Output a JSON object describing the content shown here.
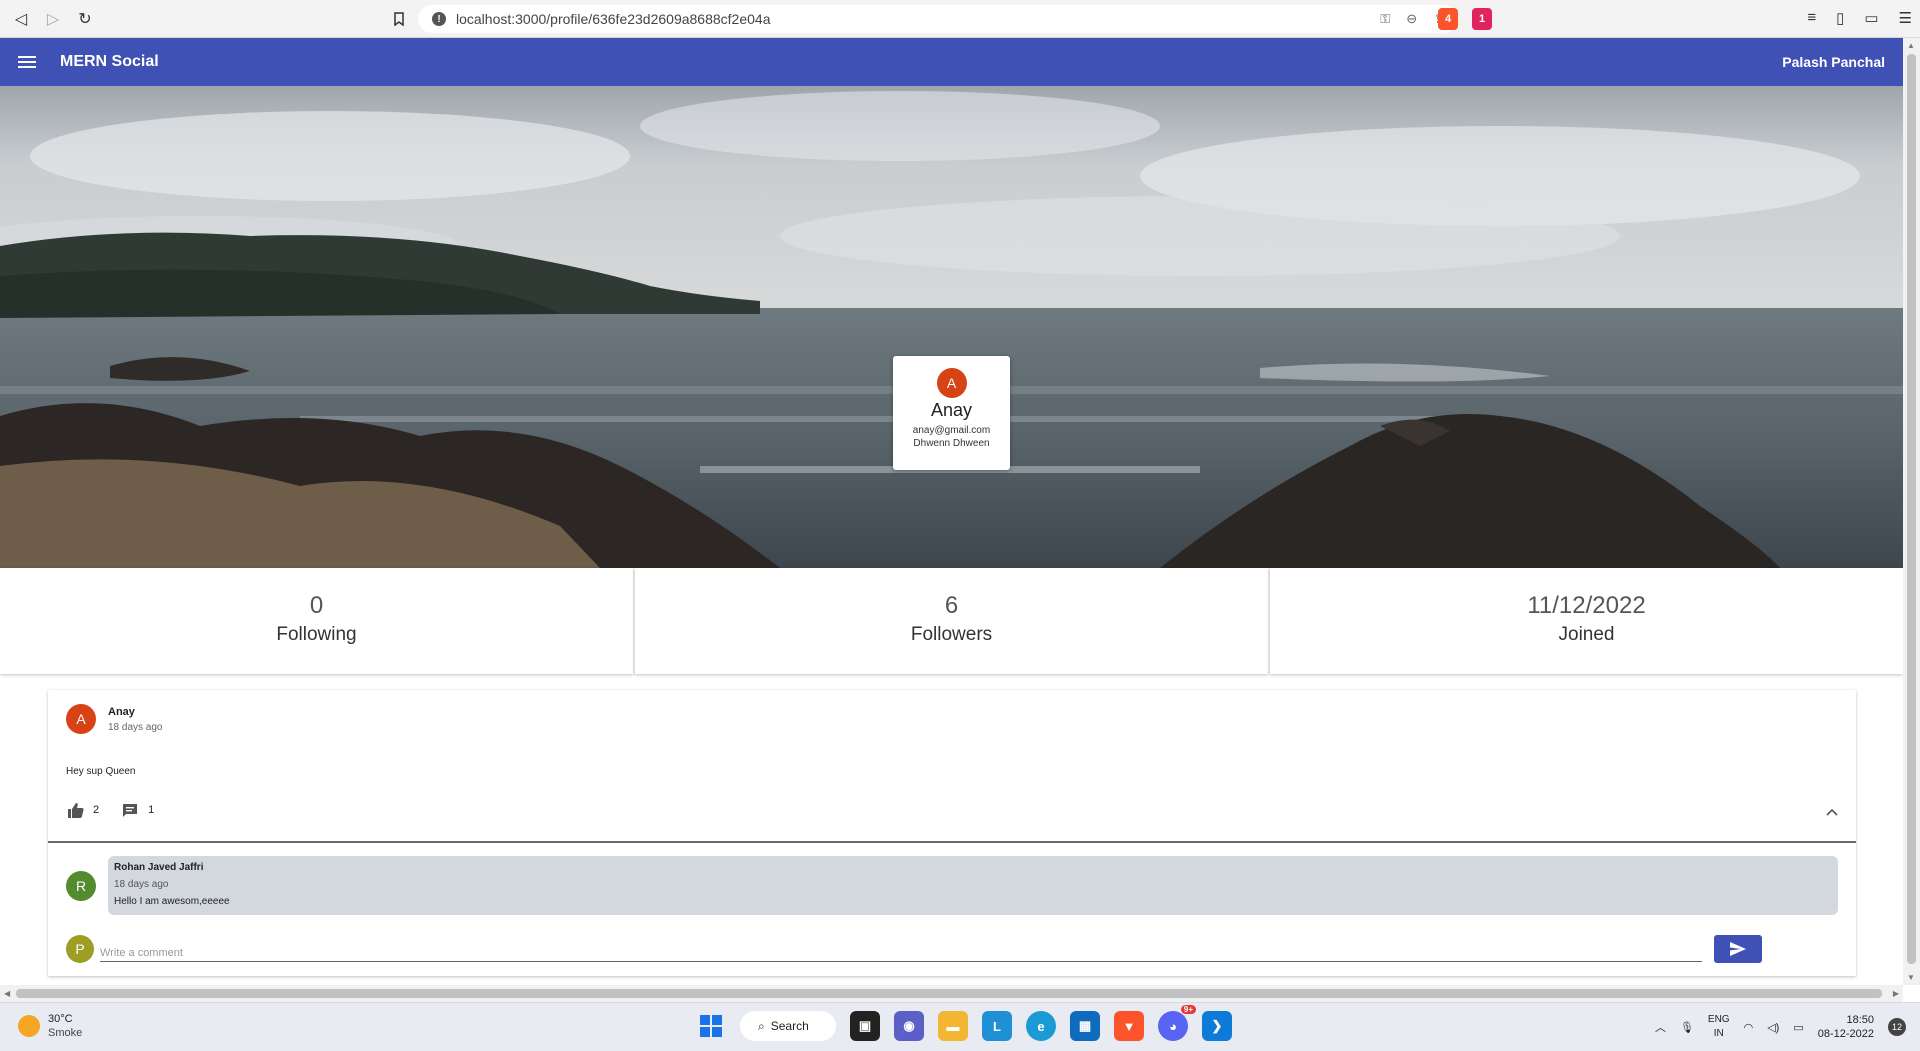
{
  "browser": {
    "url": "localhost:3000/profile/636fe23d2609a8688cf2e04a",
    "brave_badge": "4",
    "rewards_badge": "1"
  },
  "appbar": {
    "title": "MERN Social",
    "user": "Palash Panchal",
    "color": "#3f51b5"
  },
  "profile": {
    "avatar_letter": "A",
    "avatar_color": "#d84315",
    "name": "Anay",
    "email": "anay@gmail.com",
    "about": "Dhwenn Dhween"
  },
  "stats": [
    {
      "value": "0",
      "label": "Following"
    },
    {
      "value": "6",
      "label": "Followers"
    },
    {
      "value": "11/12/2022",
      "label": "Joined"
    }
  ],
  "post": {
    "author": "Anay",
    "avatar_letter": "A",
    "time": "18 days ago",
    "text": "Hey sup Queen",
    "likes": "2",
    "comments": "1",
    "comment": {
      "author": "Rohan Javed Jaffri",
      "avatar_letter": "R",
      "avatar_color": "#558b2f",
      "time": "18 days ago",
      "text": "Hello I am awesom,eeeee"
    },
    "composer": {
      "avatar_letter": "P",
      "avatar_color": "#9e9d24",
      "placeholder": "Write a comment"
    }
  },
  "taskbar": {
    "temperature": "30°C",
    "condition": "Smoke",
    "search_label": "Search",
    "lang_line1": "ENG",
    "lang_line2": "IN",
    "time": "18:50",
    "date": "08-12-2022",
    "notifications": "12",
    "discord_badge": "9+"
  }
}
